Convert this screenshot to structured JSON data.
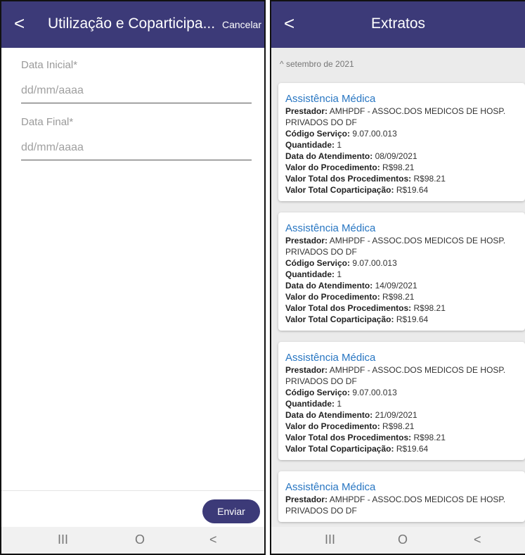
{
  "left": {
    "title": "Utilização e Coparticipa...",
    "back_icon": "<",
    "cancel": "Cancelar",
    "fields": [
      {
        "label": "Data Inicial*",
        "placeholder": "dd/mm/aaaa"
      },
      {
        "label": "Data Final*",
        "placeholder": "dd/mm/aaaa"
      }
    ],
    "send": "Enviar",
    "nav": {
      "recents": "III",
      "home": "O",
      "back": "<"
    },
    "accent": "#3c3a78"
  },
  "right": {
    "title": "Extratos",
    "back_icon": "<",
    "section_icon": "^",
    "section": "setembro de 2021",
    "labels": {
      "prestador": "Prestador:",
      "codigo": "Código Serviço:",
      "quantidade": "Quantidade:",
      "atendimento": "Data do Atendimento:",
      "valor_proc": "Valor do Procedimento:",
      "valor_total": "Valor Total dos Procedimentos:",
      "valor_copart": "Valor Total Coparticipação:"
    },
    "cards": [
      {
        "title": "Assistência Médica",
        "prestador": "AMHPDF - ASSOC.DOS MEDICOS DE HOSP. PRIVADOS DO DF",
        "codigo": "9.07.00.013",
        "quantidade": "1",
        "atendimento": "08/09/2021",
        "valor_proc": "R$98.21",
        "valor_total": "R$98.21",
        "valor_copart": "R$19.64"
      },
      {
        "title": "Assistência Médica",
        "prestador": "AMHPDF - ASSOC.DOS MEDICOS DE HOSP. PRIVADOS DO DF",
        "codigo": "9.07.00.013",
        "quantidade": "1",
        "atendimento": "14/09/2021",
        "valor_proc": "R$98.21",
        "valor_total": "R$98.21",
        "valor_copart": "R$19.64"
      },
      {
        "title": "Assistência Médica",
        "prestador": "AMHPDF - ASSOC.DOS MEDICOS DE HOSP. PRIVADOS DO DF",
        "codigo": "9.07.00.013",
        "quantidade": "1",
        "atendimento": "21/09/2021",
        "valor_proc": "R$98.21",
        "valor_total": "R$98.21",
        "valor_copart": "R$19.64"
      },
      {
        "title": "Assistência Médica",
        "prestador": "AMHPDF - ASSOC.DOS MEDICOS DE HOSP. PRIVADOS DO DF",
        "codigo": "",
        "quantidade": "",
        "atendimento": "",
        "valor_proc": "",
        "valor_total": "",
        "valor_copart": ""
      }
    ],
    "nav": {
      "recents": "III",
      "home": "O",
      "back": "<"
    },
    "accent": "#3c3a78",
    "link_color": "#2876c2"
  }
}
